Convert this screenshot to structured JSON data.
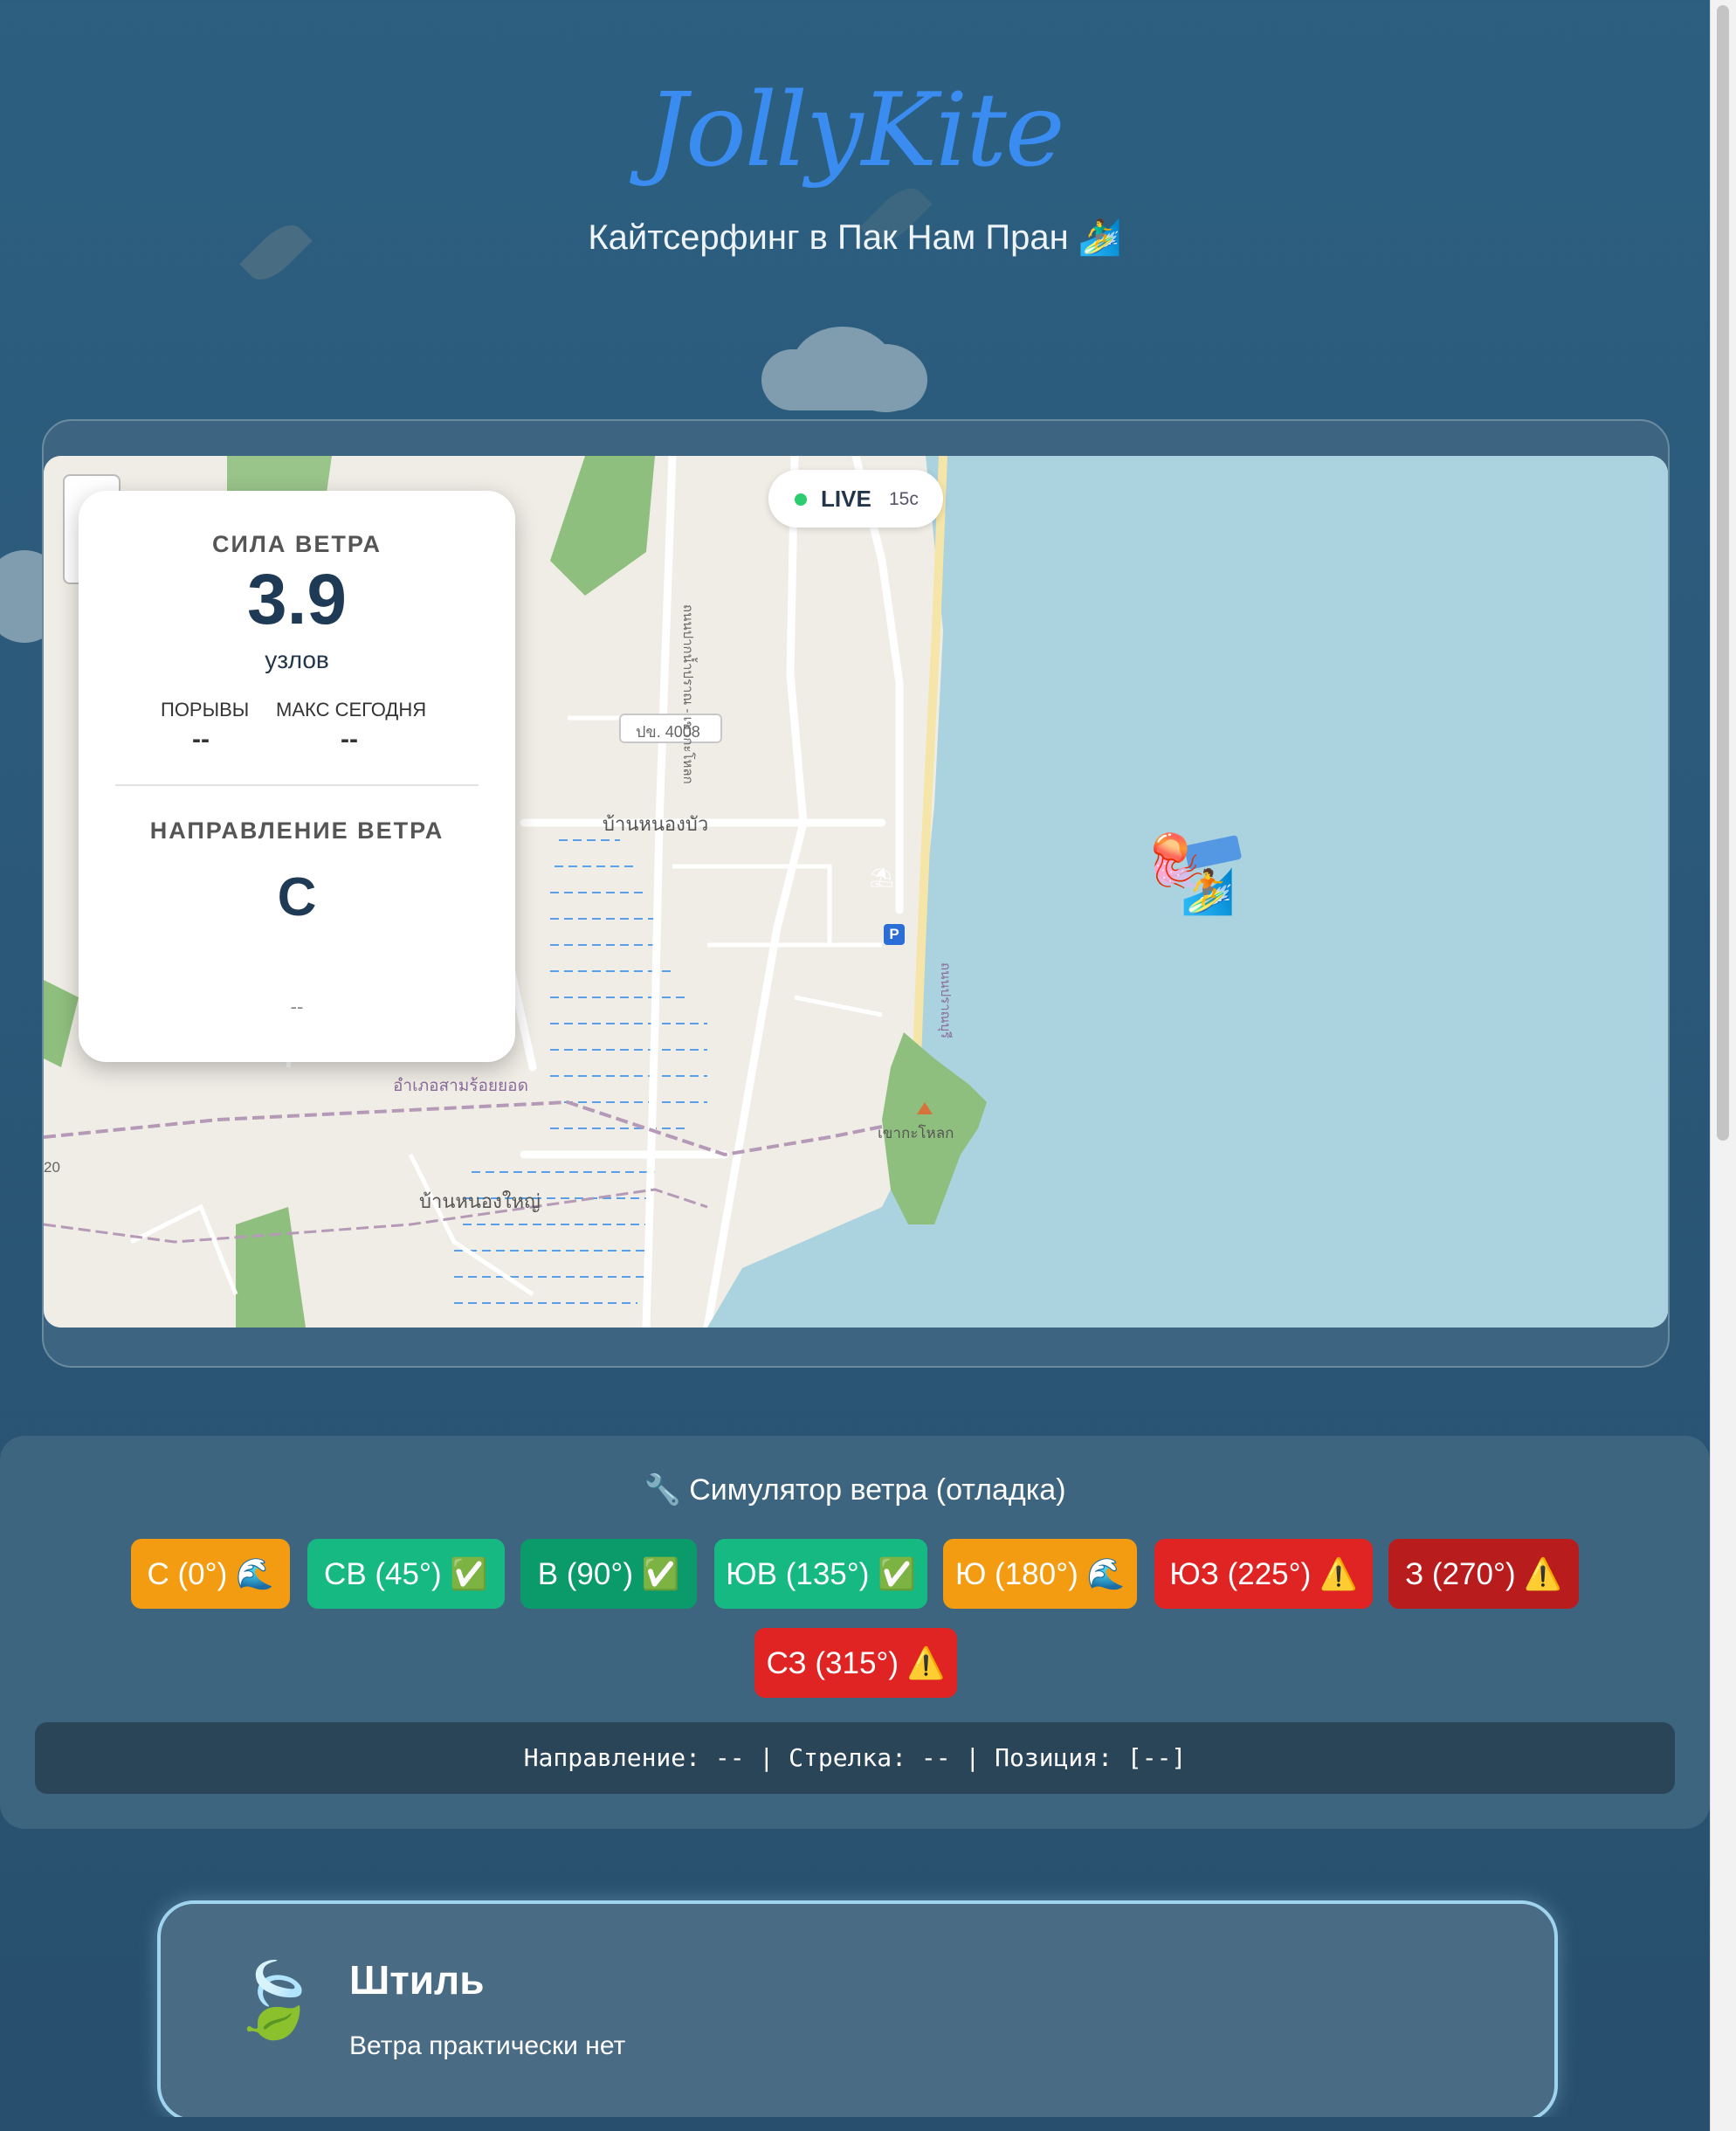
{
  "header": {
    "logo": "JollyKite",
    "subtitle": "Кайтсерфинг в Пак Нам Пран 🏄‍♂️"
  },
  "map": {
    "live_label": "LIVE",
    "live_timer": "15с",
    "labels": {
      "road_number": "ปข. 4008",
      "village_north": "บ้านหนองบัว",
      "village_south": "บ้านหนองใหญ่",
      "district": "อำเภอสามร้อยยอด",
      "hill": "เขากะโหลก",
      "road_vertical_1": "ถนนปากน้ำปราณ - เขากะโหลก",
      "road_vertical_2": "ถนนปราณบุรี",
      "route_edge": "20"
    },
    "icons": [
      "jellyfish-icon",
      "kitesurfer-icon",
      "parking-icon",
      "beach-umbrella-icon",
      "mountain-icon"
    ]
  },
  "wind_card": {
    "speed_label": "СИЛА ВЕТРА",
    "speed_value": "3.9",
    "speed_unit": "узлов",
    "gusts_label": "ПОРЫВЫ",
    "gusts_value": "--",
    "max_label": "МАКС СЕГОДНЯ",
    "max_value": "--",
    "direction_label": "НАПРАВЛЕНИЕ ВЕТРА",
    "direction_value": "С",
    "direction_footer": "--"
  },
  "simulator": {
    "title": "🔧 Симулятор ветра (отладка)",
    "buttons": [
      {
        "label": "С (0°) 🌊",
        "color": "#f39c12"
      },
      {
        "label": "СВ (45°) ✅",
        "color": "#16b981"
      },
      {
        "label": "В (90°) ✅",
        "color": "#0b9a69"
      },
      {
        "label": "ЮВ (135°) ✅",
        "color": "#16b981"
      },
      {
        "label": "Ю (180°) 🌊",
        "color": "#f39c12"
      },
      {
        "label": "ЮЗ (225°) ⚠️",
        "color": "#e02424"
      },
      {
        "label": "З (270°) ⚠️",
        "color": "#b91c1c"
      },
      {
        "label": "СЗ (315°) ⚠️",
        "color": "#e02424"
      }
    ],
    "status": "Направление: -- | Стрелка: -- | Позиция: [--]"
  },
  "condition": {
    "icon": "leaf-icon",
    "title": "Штиль",
    "description": "Ветра практически нет"
  },
  "colors": {
    "background": "#2c5f80",
    "sea": "#aad3df",
    "land": "#f0ede6",
    "park": "#6fa86b",
    "logo": "#3b8cf0"
  }
}
